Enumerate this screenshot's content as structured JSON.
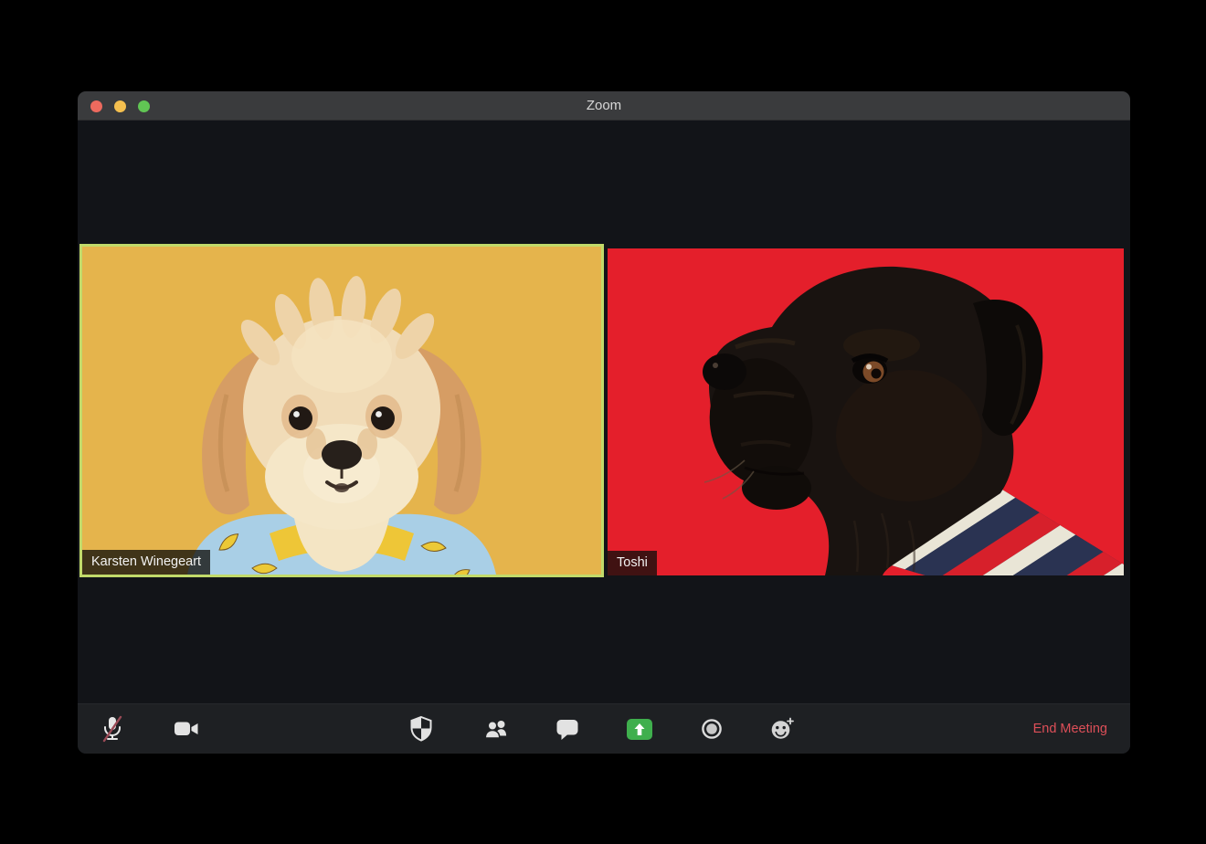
{
  "window": {
    "title": "Zoom",
    "controls": [
      {
        "id": "close"
      },
      {
        "id": "minimize"
      },
      {
        "id": "fullscreen"
      }
    ]
  },
  "meeting": {
    "participants": [
      {
        "name": "Karsten Winegeart",
        "active_speaker": true,
        "video_bg": "#e5b44c"
      },
      {
        "name": "Toshi",
        "active_speaker": false,
        "video_bg": "#e41f2b"
      }
    ]
  },
  "toolbar": {
    "buttons": [
      {
        "id": "mute",
        "icon": "microphone-muted-icon",
        "state": "muted"
      },
      {
        "id": "start-video",
        "icon": "video-camera-icon"
      },
      {
        "id": "security",
        "icon": "security-shield-icon"
      },
      {
        "id": "participants",
        "icon": "participants-icon"
      },
      {
        "id": "chat",
        "icon": "chat-bubble-icon"
      },
      {
        "id": "share-screen",
        "icon": "share-screen-up-arrow-icon",
        "accent": "#3faf4d"
      },
      {
        "id": "record",
        "icon": "record-circle-icon"
      },
      {
        "id": "reactions",
        "icon": "smiley-plus-icon"
      }
    ],
    "end_meeting_label": "End Meeting"
  },
  "colors": {
    "active_speaker_border": "#c1da6a",
    "titlebar_bg": "#3a3b3d",
    "content_bg": "#121418",
    "toolbar_bg": "#1e2023",
    "end_meeting_text": "#dd4f58",
    "share_button_green": "#3faf4d",
    "traffic_close": "#ed6a5e",
    "traffic_minimize": "#f4bf4f",
    "traffic_fullscreen": "#61c554",
    "tile1_bg": "#e5b44c",
    "tile2_bg": "#e41f2b"
  }
}
